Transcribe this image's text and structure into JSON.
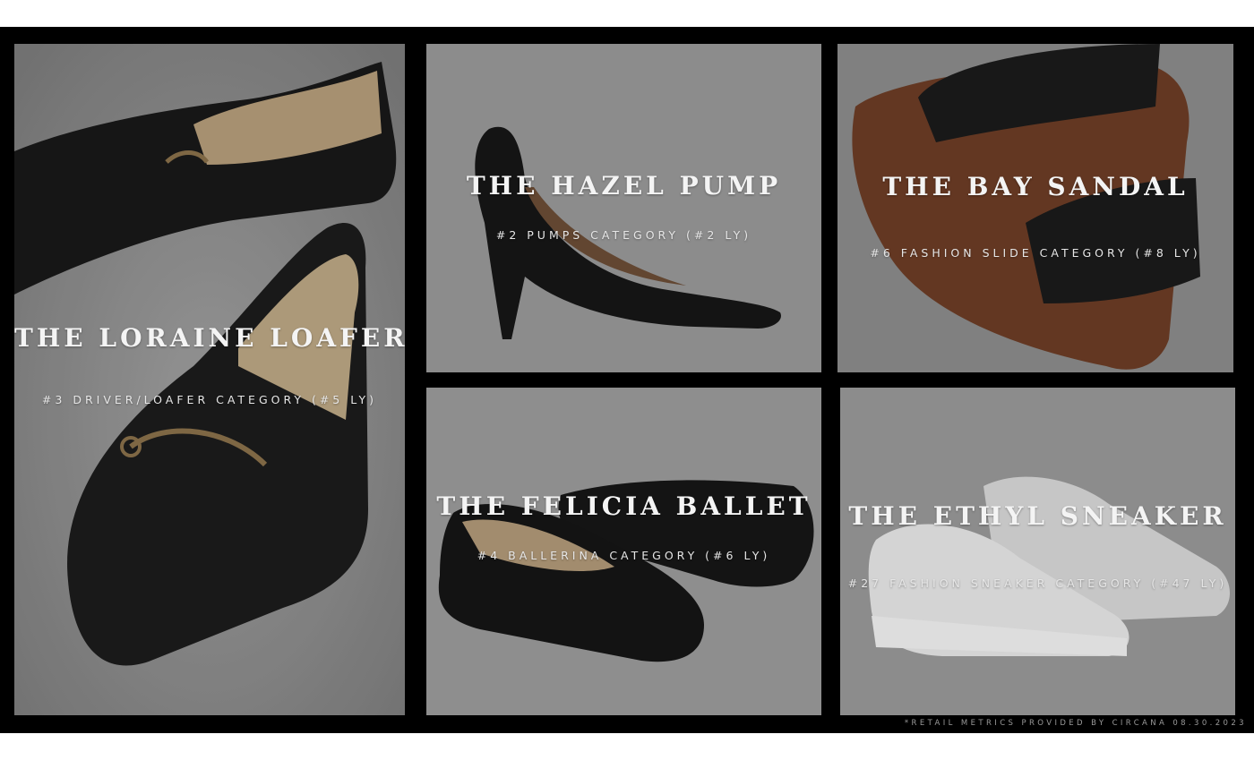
{
  "products": [
    {
      "title": "THE LORAINE LOAFER",
      "subtitle": "#3 DRIVER/LOAFER CATEGORY (#5 LY)",
      "image": "loafer-shoe-icon"
    },
    {
      "title": "THE HAZEL PUMP",
      "subtitle": "#2 PUMPS CATEGORY (#2 LY)",
      "image": "pump-heel-icon"
    },
    {
      "title": "THE BAY SANDAL",
      "subtitle": "#6 FASHION SLIDE CATEGORY (#8 LY)",
      "image": "slide-sandal-icon"
    },
    {
      "title": "THE FELICIA BALLET",
      "subtitle": "#4 BALLERINA CATEGORY (#6 LY)",
      "image": "ballet-flat-icon"
    },
    {
      "title": "THE ETHYL SNEAKER",
      "subtitle": "#27 FASHION SNEAKER CATEGORY (#47 LY)",
      "image": "sneaker-icon"
    }
  ],
  "footnote": "*RETAIL METRICS PROVIDED BY CIRCANA 08.30.2023",
  "colors": {
    "background": "#000000",
    "panel": "#8f8f8f",
    "text": "#f4f4f4",
    "shoe_black": "#141414",
    "sneaker_white": "#ececec",
    "sandal_brown": "#6b3a22"
  }
}
